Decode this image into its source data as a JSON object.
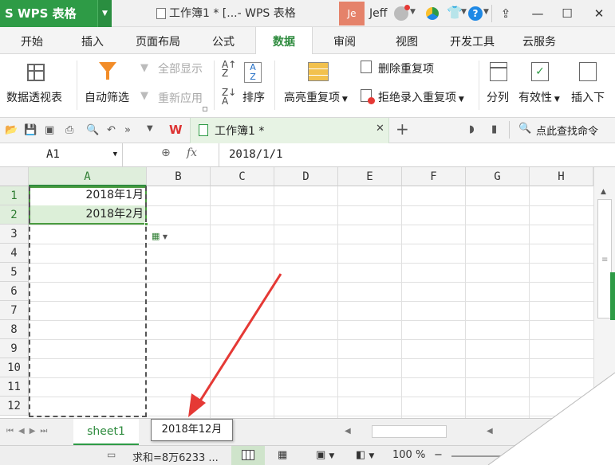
{
  "app": {
    "name": "WPS 表格",
    "window_title": "工作簿1 * [...- WPS 表格",
    "avatar_text": "Je",
    "user_name": "Jeff"
  },
  "menu_tabs": [
    "开始",
    "插入",
    "页面布局",
    "公式",
    "数据",
    "审阅",
    "视图",
    "开发工具",
    "云服务"
  ],
  "active_tab": "数据",
  "ribbon": {
    "pivot": "数据透视表",
    "autofilter": "自动筛选",
    "show_all": "全部显示",
    "reapply": "重新应用",
    "sort": "排序",
    "highlight_dup": "高亮重复项",
    "remove_dup": "删除重复项",
    "reject_dup": "拒绝录入重复项",
    "split": "分列",
    "validity": "有效性",
    "insert_down": "插入下"
  },
  "quickbar": {
    "doc_tab": "工作簿1 *",
    "search": "点此查找命令"
  },
  "formula_bar": {
    "name_box": "A1",
    "fx": "fx",
    "formula": "2018/1/1"
  },
  "columns": [
    "A",
    "B",
    "C",
    "D",
    "E",
    "F",
    "G",
    "H"
  ],
  "rows": [
    "1",
    "2",
    "3",
    "4",
    "5",
    "6",
    "7",
    "8",
    "9",
    "10",
    "11",
    "12"
  ],
  "cells": {
    "A1": "2018年1月",
    "A2": "2018年2月"
  },
  "tooltip": "2018年12月",
  "sheet_tab": "sheet1",
  "status": {
    "sum": "求和=8万6233 ...",
    "zoom": "100 %"
  },
  "colors": {
    "accent": "#2e9b46",
    "arrow": "#e53935"
  }
}
